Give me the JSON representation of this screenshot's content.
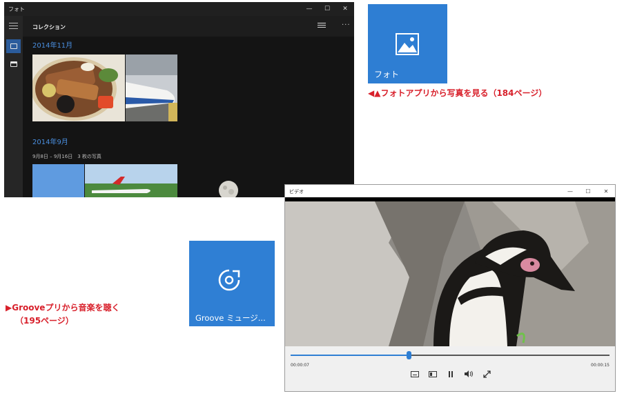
{
  "photos_window": {
    "title": "フォト",
    "header_title": "コレクション",
    "more_label": "···",
    "window_controls": {
      "minimize": "—",
      "maximize": "☐",
      "close": "✕"
    },
    "groups": [
      {
        "date": "2014年11月",
        "range": ""
      },
      {
        "date": "2014年9月",
        "range": "9月8日 – 9月16日　3 枚の写真"
      }
    ],
    "icons": {
      "menu": "hamburger-icon",
      "collection": "collection-icon",
      "albums": "album-icon",
      "view": "list-view-icon"
    }
  },
  "photos_tile": {
    "label": "フォト",
    "color": "#2e7ed3"
  },
  "photos_caption": "◀▲フォトアプリから写真を見る（184ページ）",
  "groove_caption": {
    "line1": "▶Grooveプリから音楽を聴く",
    "line2": "（195ページ）"
  },
  "groove_tile": {
    "label": "Groove ミュージ...",
    "color": "#2f7fd4"
  },
  "video_window": {
    "title": "ビデオ",
    "window_controls": {
      "minimize": "—",
      "maximize": "☐",
      "close": "✕"
    },
    "elapsed": "00:00:07",
    "remaining": "00:00:15",
    "progress": 0.37,
    "control_icons": [
      "subtitles-icon",
      "aspect-ratio-icon",
      "pause-icon",
      "volume-icon",
      "fullscreen-icon"
    ]
  },
  "accent_color": "#d8202b"
}
